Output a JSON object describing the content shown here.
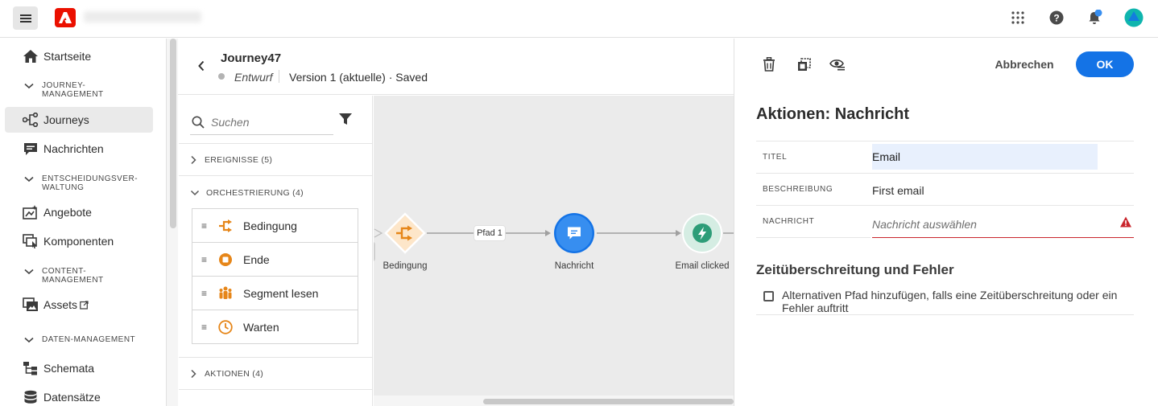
{
  "topbar": {
    "menu_icon": "hamburger-icon",
    "logo_letter": "A",
    "org_name_blurred": "",
    "icons": [
      "apps-grid-icon",
      "help-icon",
      "bell-icon",
      "avatar"
    ],
    "colors": {
      "adobe_red": "#eb1000",
      "notification_dot": "#378ef0",
      "avatar": "#0fb5ae"
    }
  },
  "nav": {
    "items": [
      {
        "label": "Startseite",
        "icon": "home-icon"
      },
      {
        "section": "JOURNEY-\nMANAGEMENT"
      },
      {
        "label": "Journeys",
        "icon": "journeys-icon",
        "active": true
      },
      {
        "label": "Nachrichten",
        "icon": "message-icon"
      },
      {
        "section": "ENTSCHEIDUNGSVER-\nWALTUNG"
      },
      {
        "label": "Angebote",
        "icon": "offers-icon"
      },
      {
        "label": "Komponenten",
        "icon": "components-icon"
      },
      {
        "section": "CONTENT-\nMANAGEMENT"
      },
      {
        "label": "Assets",
        "icon": "assets-icon",
        "external": true
      },
      {
        "section": "DATEN-MANAGEMENT"
      },
      {
        "label": "Schemata",
        "icon": "schema-icon"
      },
      {
        "label": "Datensätze",
        "icon": "dataset-icon"
      }
    ],
    "labels": {
      "startseite": "Startseite",
      "sec_journey_1": "JOURNEY-",
      "sec_journey_2": "MANAGEMENT",
      "journeys": "Journeys",
      "nachrichten": "Nachrichten",
      "sec_entsch_1": "ENTSCHEIDUNGSVER-",
      "sec_entsch_2": "WALTUNG",
      "angebote": "Angebote",
      "komponenten": "Komponenten",
      "sec_content_1": "CONTENT-",
      "sec_content_2": "MANAGEMENT",
      "assets": "Assets",
      "sec_daten": "DATEN-MANAGEMENT",
      "schemata": "Schemata",
      "datensaetze": "Datensätze"
    }
  },
  "journey": {
    "title": "Journey47",
    "status": "Entwurf",
    "version": "Version 1 (aktuelle) · Saved"
  },
  "palette": {
    "search_placeholder": "Suchen",
    "sections": {
      "events": "EREIGNISSE (5)",
      "orchestration": "ORCHESTRIERUNG (4)",
      "actions": "AKTIONEN (4)"
    },
    "orchestration_items": [
      {
        "label": "Bedingung",
        "icon": "condition-icon"
      },
      {
        "label": "Ende",
        "icon": "end-icon"
      },
      {
        "label": "Segment lesen",
        "icon": "read-segment-icon"
      },
      {
        "label": "Warten",
        "icon": "wait-icon"
      }
    ]
  },
  "canvas": {
    "nodes": [
      {
        "label": "Bedingung",
        "icon": "condition-icon"
      },
      {
        "label": "Nachricht",
        "icon": "message-icon"
      },
      {
        "label": "Email clicked",
        "icon": "event-bolt-icon"
      }
    ],
    "path_label": "Pfad 1",
    "colors": {
      "condition": "#e68619",
      "message": "#1473e6",
      "event": "#2d9d78"
    }
  },
  "panel": {
    "toolbar_icons": [
      "delete-icon",
      "duplicate-icon",
      "preview-icon"
    ],
    "cancel_label": "Abbrechen",
    "ok_label": "OK",
    "title": "Aktionen: Nachricht",
    "fields": {
      "titel_label": "TITEL",
      "titel_value": "Email",
      "beschreibung_label": "BESCHREIBUNG",
      "beschreibung_value": "First email",
      "nachricht_label": "NACHRICHT",
      "nachricht_placeholder": "Nachricht auswählen"
    },
    "section2_title": "Zeitüberschreitung und Fehler",
    "checkbox_label": "Alternativen Pfad hinzufügen, falls eine Zeitüberschreitung oder ein Fehler auftritt",
    "checkbox_checked": false,
    "colors": {
      "ok": "#1473e6",
      "error": "#c9252d"
    }
  }
}
